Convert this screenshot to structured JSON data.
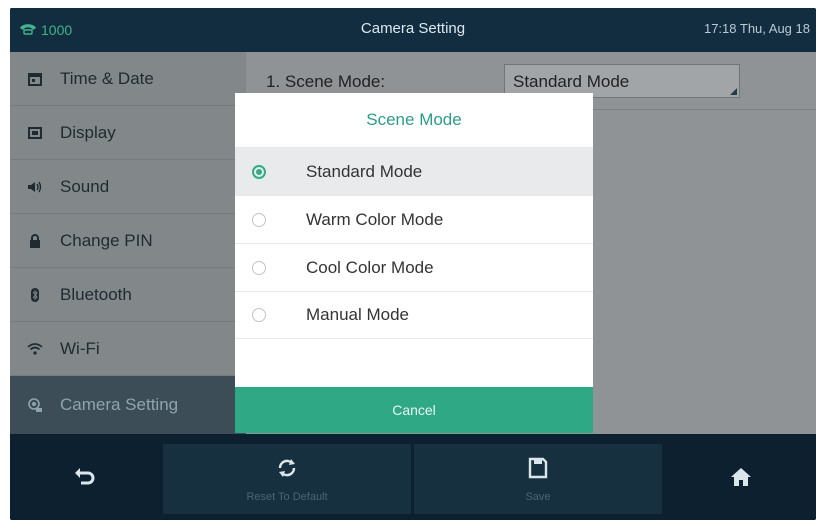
{
  "status_bar": {
    "extension": "1000",
    "title": "Camera Setting",
    "datetime": "17:18 Thu, Aug 18"
  },
  "sidebar": {
    "items": [
      {
        "label": "Time & Date",
        "icon": "calendar-icon"
      },
      {
        "label": "Display",
        "icon": "display-icon"
      },
      {
        "label": "Sound",
        "icon": "speaker-icon"
      },
      {
        "label": "Change PIN",
        "icon": "lock-icon"
      },
      {
        "label": "Bluetooth",
        "icon": "bluetooth-icon"
      },
      {
        "label": "Wi-Fi",
        "icon": "wifi-icon"
      },
      {
        "label": "Camera Setting",
        "icon": "camera-setting-icon",
        "active": true
      }
    ]
  },
  "main": {
    "scene_mode_label": "1. Scene Mode:",
    "scene_mode_value": "Standard Mode"
  },
  "dialog": {
    "title": "Scene Mode",
    "options": [
      {
        "label": "Standard Mode",
        "selected": true
      },
      {
        "label": "Warm Color Mode",
        "selected": false
      },
      {
        "label": "Cool Color Mode",
        "selected": false
      },
      {
        "label": "Manual Mode",
        "selected": false
      }
    ],
    "cancel_label": "Cancel"
  },
  "bottom_bar": {
    "reset_label": "Reset To Default",
    "save_label": "Save"
  },
  "colors": {
    "accent": "#2fa985",
    "topbar": "#122d3f",
    "bottombar": "#0d2030"
  }
}
